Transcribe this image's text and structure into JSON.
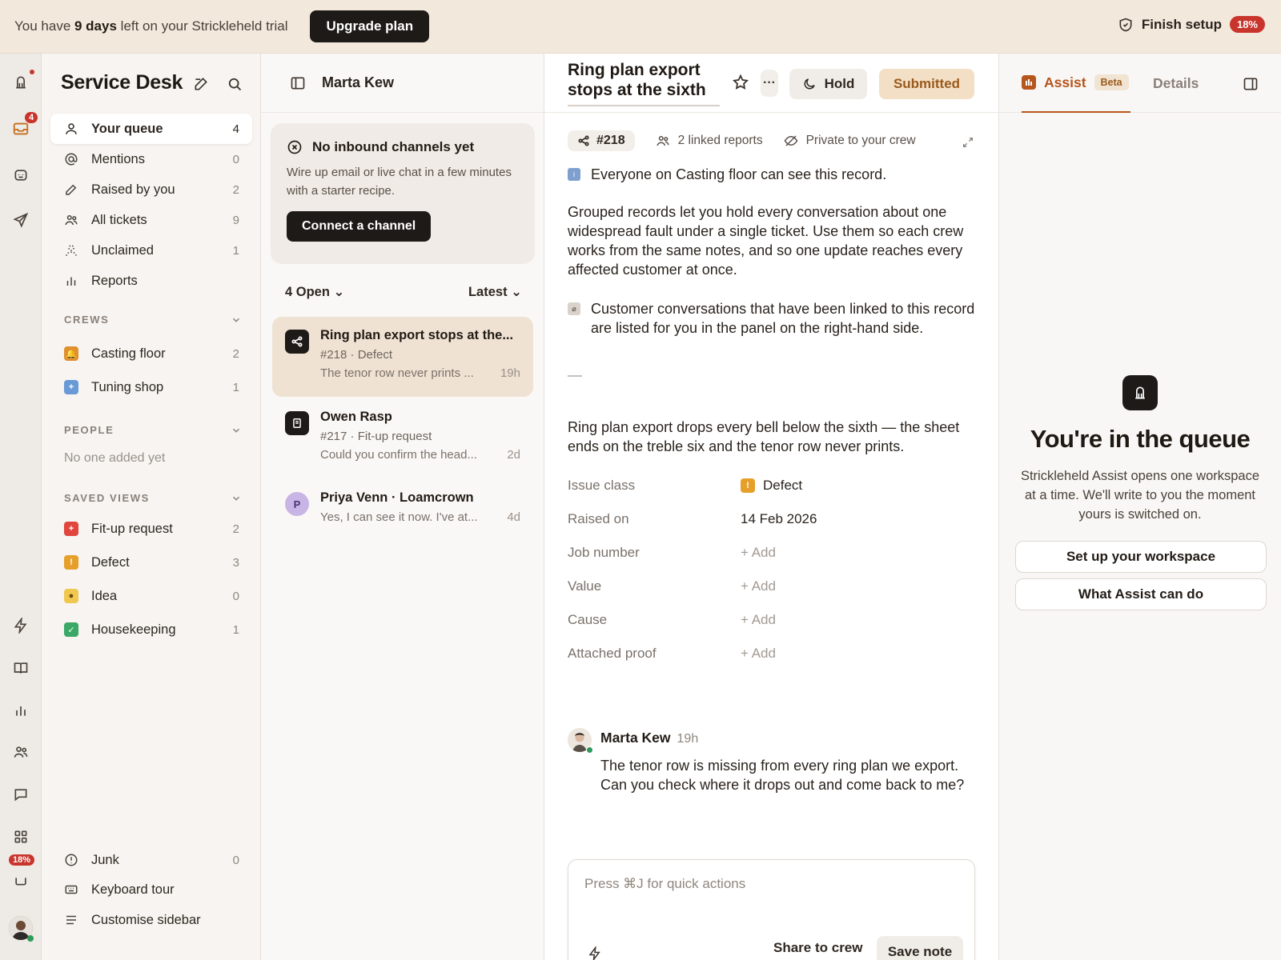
{
  "banner": {
    "prefix": "You have ",
    "days": "9 days",
    "suffix": " left on your Strickleheld trial",
    "upgrade_label": "Upgrade plan",
    "setup_label": "Finish setup",
    "setup_percent": "18%"
  },
  "rail": {
    "inbox_badge": "4",
    "trial_badge": "18%",
    "icons": [
      "bell-icon",
      "inbox-icon",
      "bot-icon",
      "send-icon",
      "bolt-icon",
      "book-icon",
      "chart-icon",
      "people-icon",
      "chat-icon",
      "apps-icon",
      "trial-icon"
    ]
  },
  "sidebar": {
    "title": "Service Desk",
    "nav": [
      {
        "label": "Your queue",
        "count": "4"
      },
      {
        "label": "Mentions",
        "count": "0"
      },
      {
        "label": "Raised by you",
        "count": "2"
      },
      {
        "label": "All tickets",
        "count": "9"
      },
      {
        "label": "Unclaimed",
        "count": "1"
      },
      {
        "label": "Reports",
        "count": ""
      }
    ],
    "crews_heading": "CREWS",
    "crews": [
      {
        "label": "Casting floor",
        "count": "2",
        "color": "#e0902e"
      },
      {
        "label": "Tuning shop",
        "count": "1",
        "color": "#6a9ad6"
      }
    ],
    "people_heading": "PEOPLE",
    "people_empty": "No one added yet",
    "views_heading": "SAVED VIEWS",
    "views": [
      {
        "label": "Fit-up request",
        "count": "2",
        "color": "#e0463e"
      },
      {
        "label": "Defect",
        "count": "3",
        "color": "#e6a02a"
      },
      {
        "label": "Idea",
        "count": "0",
        "color": "#f0c850"
      },
      {
        "label": "Housekeeping",
        "count": "1",
        "color": "#3aa866"
      }
    ],
    "footer": [
      {
        "label": "Junk",
        "count": "0"
      },
      {
        "label": "Keyboard tour",
        "count": ""
      },
      {
        "label": "Customise sidebar",
        "count": ""
      }
    ]
  },
  "list": {
    "title": "Marta Kew",
    "callout": {
      "title": "No inbound channels yet",
      "body": "Wire up email or live chat in a few minutes with a starter recipe.",
      "button": "Connect a channel"
    },
    "filter": "4 Open",
    "sort": "Latest",
    "tickets": [
      {
        "title": "Ring plan export stops at the...",
        "meta": "#218 · Defect",
        "preview": "The tenor row never prints ...",
        "time": "19h"
      },
      {
        "title": "Owen Rasp",
        "meta": "#217 · Fit-up request",
        "preview": "Could you confirm the head...",
        "time": "2d"
      },
      {
        "title": "Priya Venn · Loamcrown",
        "meta": "",
        "preview": "Yes, I can see it now. I've at...",
        "time": "4d",
        "initial": "P"
      }
    ]
  },
  "detail": {
    "title": "Ring plan export stops at the sixth",
    "hold_label": "Hold",
    "status_label": "Submitted",
    "id": "#218",
    "linked": "2 linked reports",
    "privacy": "Private to your crew",
    "notice": "Everyone on Casting floor can see this record.",
    "para1": "Grouped records let you hold every conversation about one widespread fault under a single ticket. Use them so each crew works from the same notes, and so one update reaches every affected customer at once.",
    "para2": "Customer conversations that have been linked to this record are listed for you in the panel on the right-hand side.",
    "summary": "Ring plan export drops every bell below the sixth — the sheet ends on the treble six and the tenor row never prints.",
    "fields": [
      {
        "label": "Issue class",
        "value": "Defect"
      },
      {
        "label": "Raised on",
        "value": "14 Feb 2026"
      },
      {
        "label": "Job number",
        "value": "+ Add"
      },
      {
        "label": "Value",
        "value": "+ Add"
      },
      {
        "label": "Cause",
        "value": "+ Add"
      },
      {
        "label": "Attached proof",
        "value": "+ Add"
      }
    ],
    "comment": {
      "author": "Marta Kew",
      "time": "19h",
      "body": "The tenor row is missing from every ring plan we export. Can you check where it drops out and come back to me?"
    },
    "composer": {
      "placeholder": "Press ⌘J for quick actions",
      "share_label": "Share to crew",
      "save_label": "Save note"
    }
  },
  "assist": {
    "tab_assist": "Assist",
    "beta": "Beta",
    "tab_details": "Details",
    "title": "You're in the queue",
    "body": "Strickleheld Assist opens one workspace at a time. We'll write to you the moment yours is switched on.",
    "btn_setup": "Set up your workspace",
    "btn_what": "What Assist can do"
  }
}
